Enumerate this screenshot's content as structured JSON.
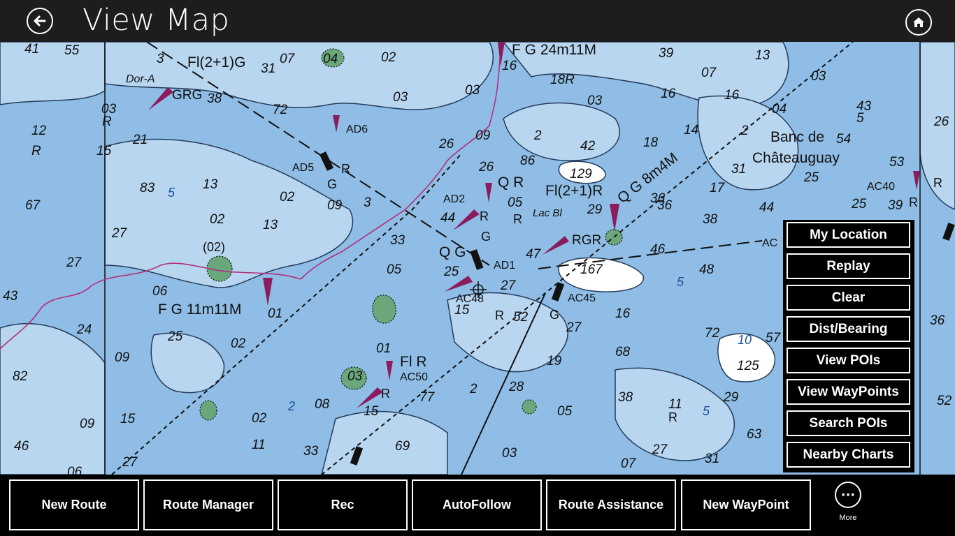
{
  "header": {
    "title": "View Map",
    "back_icon": "back-arrow-icon",
    "home_icon": "home-icon"
  },
  "map": {
    "colors": {
      "deep_water": "#8fbde5",
      "shallow_water": "#b9d6f1",
      "land": "#ffffff",
      "marker": "#8b1c5e",
      "buoy": "#111111"
    },
    "soundings": [
      "41",
      "55",
      "3",
      "07",
      "04",
      "02",
      "31",
      "38",
      "72",
      "03",
      "12",
      "21",
      "15",
      "R",
      "R",
      "83",
      "13",
      "67",
      "02",
      "09",
      "27",
      "43",
      "27",
      "24",
      "06",
      "82",
      "09",
      "25",
      "02",
      "12",
      "16",
      "18R",
      "03",
      "05",
      "26",
      "09",
      "2",
      "42",
      "86",
      "129",
      "29",
      "36",
      "16",
      "16",
      "04",
      "2",
      "03",
      "07",
      "39",
      "14",
      "18",
      "17",
      "31",
      "38",
      "44",
      "25",
      "53",
      "46",
      "48",
      "5",
      "AD6",
      "AD5",
      "AD2",
      "AD1",
      "AC48",
      "AC45",
      "AC50",
      "AC40",
      "AC",
      "G",
      "G",
      "R",
      "R",
      "R",
      "R",
      "R",
      "R",
      "R",
      "G",
      "01",
      "03",
      "08",
      "02",
      "11",
      "33",
      "69",
      "77",
      "28",
      "2",
      "19",
      "68",
      "16",
      "27",
      "52",
      "05",
      "03",
      "07",
      "27",
      "31",
      "63",
      "29",
      "57",
      "125",
      "72",
      "10",
      "5",
      "52",
      "36",
      "26"
    ],
    "light_labels": [
      "Fl(2+1)G",
      "GRG",
      "Dor-A",
      "FG 24m11M",
      "QR",
      "Fl(2+1)R",
      "QG 8m4M",
      "RGR",
      "Lac Bl",
      "QG",
      "FG 11m11M",
      "Fl R",
      "(02)"
    ],
    "place_names": [
      "Banc de",
      "Châteauguay"
    ]
  },
  "side_panel": {
    "buttons": [
      "My Location",
      "Replay",
      "Clear",
      "Dist/Bearing",
      "View POIs",
      "View WayPoints",
      "Search POIs",
      "Nearby Charts"
    ]
  },
  "app_bar": {
    "buttons": [
      "New Route",
      "Route Manager",
      "Rec",
      "AutoFollow",
      "Route Assistance",
      "New WayPoint"
    ],
    "more_label": "More",
    "more_icon": "ellipsis-icon"
  }
}
